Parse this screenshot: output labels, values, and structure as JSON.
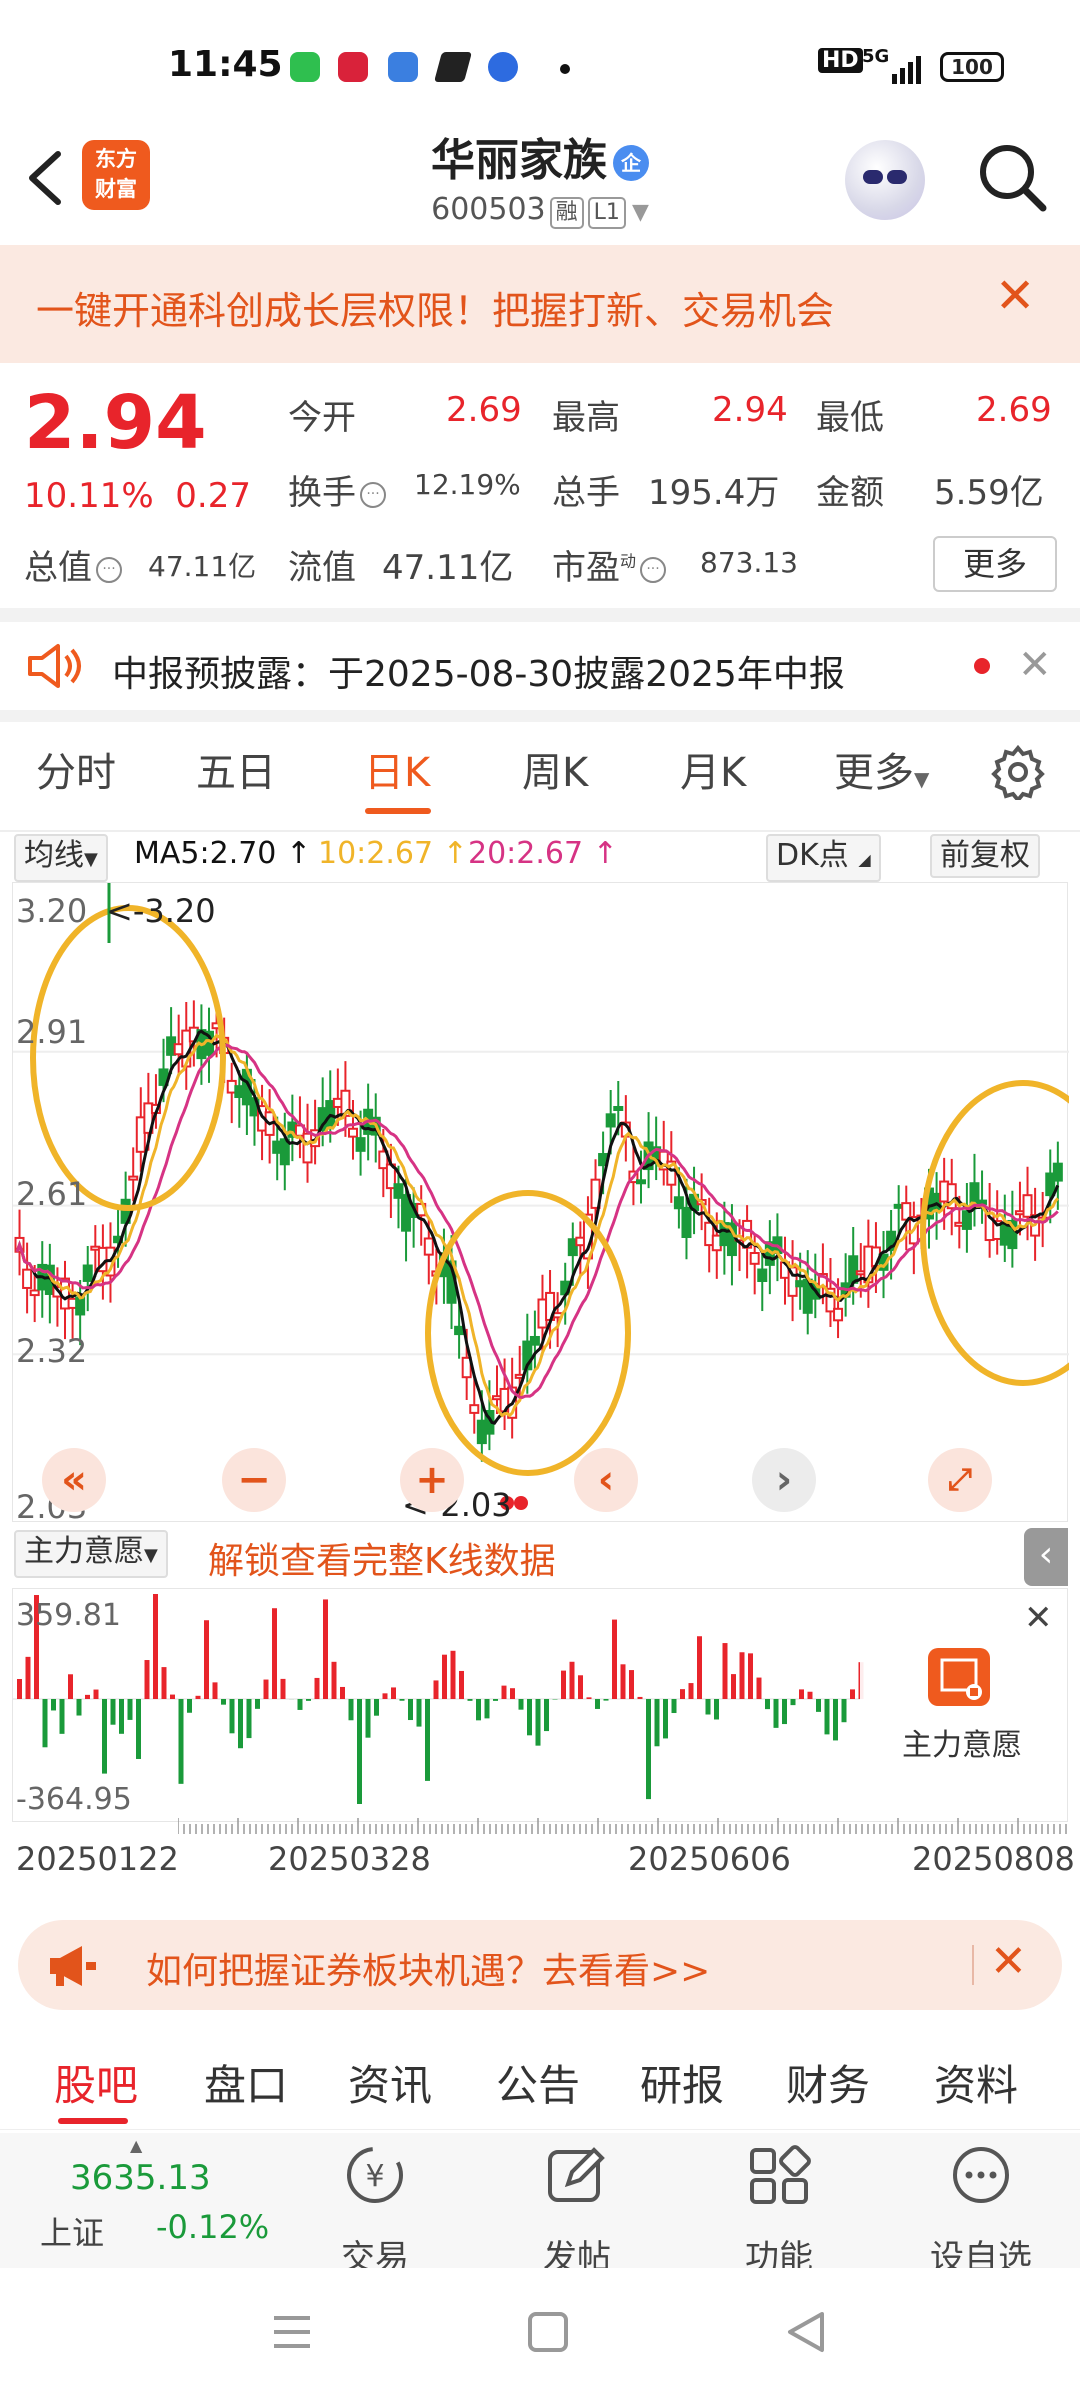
{
  "status_bar": {
    "time": "11:45",
    "signal": "5G",
    "hd": "HD",
    "battery": "100"
  },
  "header": {
    "logo_line1": "东方",
    "logo_line2": "财富",
    "title": "华丽家族",
    "title_badge": "企",
    "code": "600503",
    "tag1": "融",
    "tag2": "L1"
  },
  "banner": {
    "text": "一键开通科创成长层权限！把握打新、交易机会"
  },
  "quote": {
    "price": "2.94",
    "change_pct": "10.11%",
    "change": "0.27",
    "open_label": "今开",
    "open": "2.69",
    "high_label": "最高",
    "high": "2.94",
    "low_label": "最低",
    "low": "2.69",
    "turnover_label": "换手",
    "turnover": "12.19%",
    "volume_label": "总手",
    "volume": "195.4万",
    "amount_label": "金额",
    "amount": "5.59亿",
    "mcap_label": "总值",
    "mcap": "47.11亿",
    "float_label": "流值",
    "float": "47.11亿",
    "pe_label": "市盈",
    "pe_sup": "动",
    "pe": "873.13",
    "more": "更多"
  },
  "notice": {
    "text": "中报预披露：于2025-08-30披露2025年中报"
  },
  "chart_tabs": [
    "分时",
    "五日",
    "日K",
    "周K",
    "月K",
    "更多"
  ],
  "ma": {
    "selector": "均线",
    "ma5": "MA5:2.70",
    "ma10": "10:2.67",
    "ma20": "20:2.67",
    "dk": "DK点",
    "adjust": "前复权"
  },
  "kline": {
    "y_ticks": [
      "3.20",
      "2.91",
      "2.61",
      "2.32",
      "2.03"
    ],
    "max_label": "<-3.20",
    "min_label": "<-2.03"
  },
  "indicator": {
    "selector": "主力意愿",
    "unlock": "解锁查看完整K线数据",
    "top": "359.81",
    "bottom": "-364.95",
    "overlay_label": "主力意愿"
  },
  "dates": [
    "20250122",
    "20250328",
    "20250606",
    "20250808"
  ],
  "promo": {
    "text": "如何把握证券板块机遇？去看看>>"
  },
  "sub_tabs": [
    "股吧",
    "盘口",
    "资讯",
    "公告",
    "研报",
    "财务",
    "资料"
  ],
  "bottom_bar": {
    "index_value": "3635.13",
    "index_name": "上证",
    "index_change": "-0.12%",
    "items": [
      "交易",
      "发帖",
      "功能",
      "设自选"
    ]
  },
  "colors": {
    "accent": "#ef5a1e",
    "up": "#e8242b",
    "down": "#1a9a3a",
    "ma5": "#111111",
    "ma10": "#f0b429",
    "ma20": "#d63384"
  }
}
